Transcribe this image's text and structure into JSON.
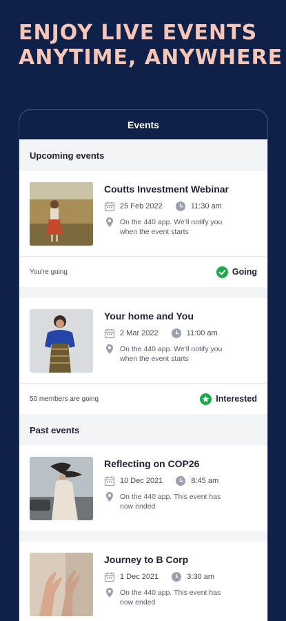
{
  "headline": {
    "line1": "ENJOY LIVE EVENTS",
    "line2": "ANYTIME, ANYWHERE"
  },
  "header": {
    "title": "Events"
  },
  "upcoming": {
    "title": "Upcoming events",
    "events": [
      {
        "title": "Coutts Investment Webinar",
        "date": "25 Feb 2022",
        "time": "11:30 am",
        "location_line1": "On the 440 app. We'll notify you",
        "location_line2": "when the event starts",
        "footer_left": "You're going",
        "status": "Going",
        "status_icon": "check-circle-icon"
      },
      {
        "title": "Your home and You",
        "date": "2 Mar 2022",
        "time": "11:00 am",
        "location_line1": "On the 440 app. We'll notify you",
        "location_line2": "when the event starts",
        "footer_left": "50 members are going",
        "status": "Interested",
        "status_icon": "star-circle-icon"
      }
    ]
  },
  "past": {
    "title": "Past events",
    "events": [
      {
        "title": "Reflecting on COP26",
        "date": "10 Dec 2021",
        "time": "8:45 am",
        "location_line1": "On the 440 app. This event has",
        "location_line2": "now ended"
      },
      {
        "title": "Journey to B Corp",
        "date": "1 Dec 2021",
        "time": "3:30 am",
        "location_line1": "On the 440 app. This event has",
        "location_line2": "now ended"
      }
    ]
  },
  "colors": {
    "navy": "#0f2148",
    "accent_green": "#1ea94b",
    "headline": "#f6c6b8"
  }
}
